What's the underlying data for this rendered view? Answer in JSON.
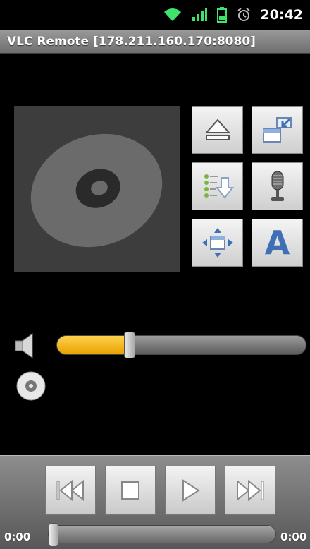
{
  "status_bar": {
    "clock": "20:42",
    "icons": [
      "wifi-icon",
      "signal-icon",
      "battery-icon",
      "alarm-icon"
    ]
  },
  "app": {
    "title": "VLC Remote [178.211.160.170:8080]"
  },
  "album_art": {
    "icon": "disc-icon"
  },
  "control_grid": [
    {
      "name": "eject-button",
      "icon": "eject-icon"
    },
    {
      "name": "windowed-mode-button",
      "icon": "minimize-window-icon"
    },
    {
      "name": "playlist-button",
      "icon": "playlist-icon"
    },
    {
      "name": "audio-track-button",
      "icon": "microphone-icon"
    },
    {
      "name": "fullscreen-button",
      "icon": "move-arrows-icon"
    },
    {
      "name": "subtitles-button",
      "icon": "letter-a-icon",
      "glyph": "A"
    }
  ],
  "volume": {
    "icon": "speaker-icon",
    "level": 0.29
  },
  "disc_toggle": {
    "icon": "cd-icon"
  },
  "transport": {
    "buttons": [
      {
        "name": "previous-button",
        "icon": "skip-previous-icon"
      },
      {
        "name": "stop-button",
        "icon": "stop-icon"
      },
      {
        "name": "play-button",
        "icon": "play-icon"
      },
      {
        "name": "next-button",
        "icon": "skip-next-icon"
      }
    ]
  },
  "seek": {
    "elapsed": "0:00",
    "duration": "0:00",
    "position": 0.0
  },
  "colors": {
    "accent": "#f2b51a",
    "background": "#000000",
    "icon_blue": "#3f6fb4"
  }
}
